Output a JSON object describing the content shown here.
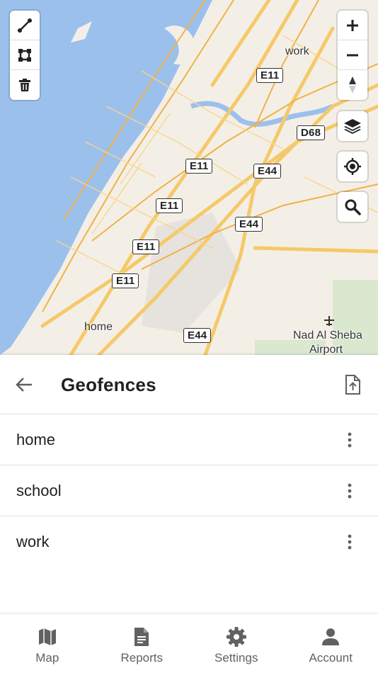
{
  "map": {
    "road_labels": [
      "E11",
      "E11",
      "E11",
      "E11",
      "E11",
      "E44",
      "E44",
      "E44",
      "D68"
    ],
    "place_labels": {
      "work": "work",
      "home": "home",
      "airport_line1": "Nad Al Sheba",
      "airport_line2": "Airport"
    },
    "colors": {
      "water": "#9cc0ec",
      "land": "#f4efe6",
      "road": "#f5c96a",
      "park": "#d9e8cf"
    }
  },
  "panel": {
    "title": "Geofences",
    "items": [
      {
        "label": "home"
      },
      {
        "label": "school"
      },
      {
        "label": "work"
      }
    ]
  },
  "bottom_nav": {
    "items": [
      {
        "label": "Map",
        "icon": "map-icon"
      },
      {
        "label": "Reports",
        "icon": "document-icon"
      },
      {
        "label": "Settings",
        "icon": "gear-icon"
      },
      {
        "label": "Account",
        "icon": "person-icon"
      }
    ]
  }
}
